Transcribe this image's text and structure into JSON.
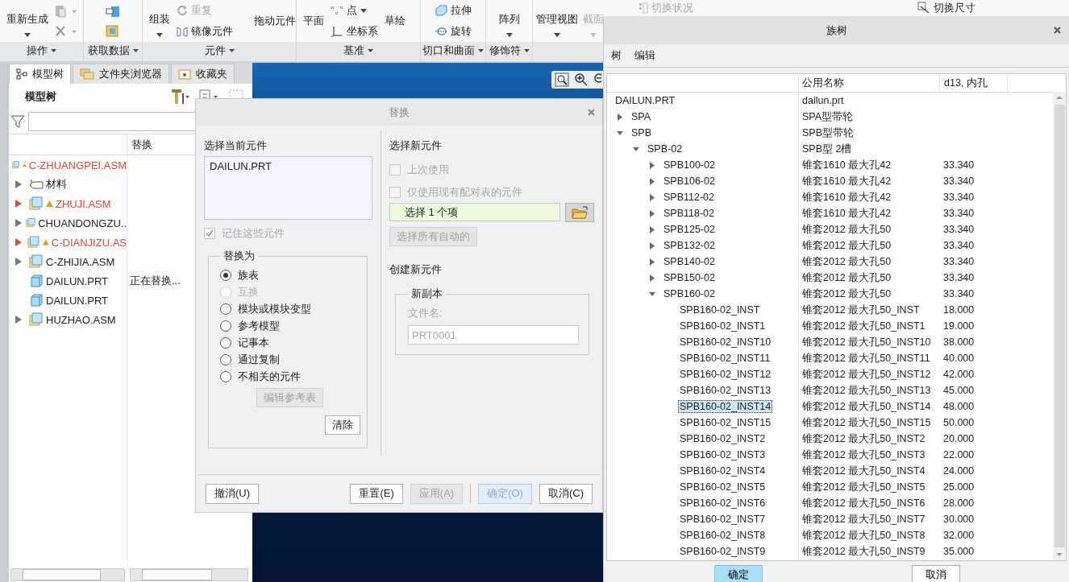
{
  "ribbon": {
    "groups": [
      {
        "label": "操作",
        "items": [
          {
            "label": "重新生成",
            "disabled": false
          }
        ]
      },
      {
        "label": "获取数据"
      },
      {
        "label": "元件",
        "items": [
          {
            "label": "组装",
            "disabled": false
          },
          {
            "label": "重复",
            "disabled": true
          },
          {
            "label": "镜像元件",
            "disabled": false
          },
          {
            "label": "拖动元件",
            "disabled": false
          }
        ]
      },
      {
        "label": "基准",
        "items": [
          {
            "label": "平面",
            "disabled": false
          },
          {
            "label": "点",
            "disabled": false
          },
          {
            "label": "坐标系",
            "disabled": false
          },
          {
            "label": "草绘",
            "disabled": false
          }
        ]
      },
      {
        "label": "切口和曲面",
        "items": [
          {
            "label": "拉伸",
            "disabled": false
          },
          {
            "label": "旋转",
            "disabled": false
          }
        ]
      },
      {
        "label": "修饰符",
        "items": [
          {
            "label": "阵列",
            "disabled": false
          }
        ]
      },
      {
        "items": [
          {
            "label": "管理视图",
            "disabled": false
          },
          {
            "label": "截面",
            "disabled": true
          }
        ]
      }
    ],
    "overflow_items": [
      {
        "label": "切换状况",
        "disabled": true
      },
      {
        "label": "切换尺寸",
        "disabled": false
      }
    ]
  },
  "left_panel": {
    "tabs": [
      {
        "label": "模型树",
        "selected": true
      },
      {
        "label": "文件夹浏览器",
        "selected": false
      },
      {
        "label": "收藏夹",
        "selected": false
      }
    ],
    "title": "模型树",
    "columns": [
      "替换"
    ],
    "tree": {
      "name": "C-ZHUANGPEI.ASM",
      "kind": "assembly",
      "warning": true,
      "children": [
        {
          "name": "材料",
          "kind": "material",
          "warning": false,
          "expanded": false
        },
        {
          "name": "ZHUJI.ASM",
          "kind": "assembly",
          "warning": true,
          "expanded": false
        },
        {
          "name": "CHUANDONGZU..",
          "kind": "assembly",
          "warning": false,
          "expanded": false
        },
        {
          "name": "C-DIANJIZU.AS",
          "kind": "assembly",
          "warning": true,
          "expanded": false
        },
        {
          "name": "C-ZHIJIA.ASM",
          "kind": "assembly",
          "warning": false,
          "expanded": false
        },
        {
          "name": "DAILUN.PRT",
          "kind": "part",
          "warning": false,
          "replace": "正在替换..."
        },
        {
          "name": "DAILUN.PRT",
          "kind": "part",
          "warning": false
        },
        {
          "name": "HUZHAO.ASM",
          "kind": "assembly",
          "warning": false,
          "expanded": false
        }
      ]
    }
  },
  "replace_dialog": {
    "title": "替换",
    "current_label": "选择当前元件",
    "current_items": [
      "DAILUN.PRT"
    ],
    "remember": {
      "label": "记住这些元件",
      "checked": true,
      "disabled": true
    },
    "replace_with": {
      "legend": "替换为",
      "options": [
        {
          "label": "族表",
          "selected": true,
          "disabled": false
        },
        {
          "label": "互换",
          "selected": false,
          "disabled": true
        },
        {
          "label": "模块或模块变型",
          "selected": false,
          "disabled": false
        },
        {
          "label": "参考模型",
          "selected": false,
          "disabled": false
        },
        {
          "label": "记事本",
          "selected": false,
          "disabled": false
        },
        {
          "label": "通过复制",
          "selected": false,
          "disabled": false
        },
        {
          "label": "不相关的元件",
          "selected": false,
          "disabled": false
        }
      ],
      "edit_button": {
        "label": "编辑参考表",
        "disabled": true
      },
      "clear_button": "清除"
    },
    "new_label": "选择新元件",
    "new_options": [
      {
        "label": "上次使用",
        "checked": false,
        "disabled": true
      },
      {
        "label": "仅使用现有配对表的元件",
        "checked": false,
        "disabled": true
      }
    ],
    "selector": "选择 1 个项",
    "auto_button": {
      "label": "选择所有自动的",
      "disabled": true
    },
    "create_label": "创建新元件",
    "copy": {
      "legend": "新副本",
      "file_label": "文件名:",
      "file_value": "PRT0001",
      "disabled": true
    },
    "buttons": [
      {
        "label": "撤消(U)",
        "disabled": false,
        "default": false
      },
      {
        "label": "重置(E)",
        "disabled": false,
        "default": false
      },
      {
        "label": "应用(A)",
        "disabled": true,
        "default": false
      },
      {
        "label": "确定(O)",
        "disabled": true,
        "default": true
      },
      {
        "label": "取消(C)",
        "disabled": false,
        "default": false
      }
    ]
  },
  "family_tree": {
    "title": "族树",
    "menu": [
      "树",
      "编辑"
    ],
    "columns": [
      "公用名称",
      "d13, 内孔"
    ],
    "rows": [
      {
        "name": "DAILUN.PRT",
        "common": "dailun.prt",
        "selected": false,
        "children": [
          {
            "name": "SPA",
            "common": "SPA型带轮",
            "expanded": false,
            "selected": false
          },
          {
            "name": "SPB",
            "common": "SPB型带轮",
            "expanded": true,
            "selected": false,
            "children": [
              {
                "name": "SPB-02",
                "common": "SPB型 2槽",
                "expanded": true,
                "selected": false,
                "children": [
                  {
                    "name": "SPB100-02",
                    "common": "锥套1610 最大孔42",
                    "value": "33.340",
                    "expanded": false,
                    "selected": false
                  },
                  {
                    "name": "SPB106-02",
                    "common": "锥套1610 最大孔42",
                    "value": "33.340",
                    "expanded": false,
                    "selected": false
                  },
                  {
                    "name": "SPB112-02",
                    "common": "锥套1610 最大孔42",
                    "value": "33.340",
                    "expanded": false,
                    "selected": false
                  },
                  {
                    "name": "SPB118-02",
                    "common": "锥套1610 最大孔42",
                    "value": "33.340",
                    "expanded": false,
                    "selected": false
                  },
                  {
                    "name": "SPB125-02",
                    "common": "锥套2012 最大孔50",
                    "value": "33.340",
                    "expanded": false,
                    "selected": false
                  },
                  {
                    "name": "SPB132-02",
                    "common": "锥套2012 最大孔50",
                    "value": "33.340",
                    "expanded": false,
                    "selected": false
                  },
                  {
                    "name": "SPB140-02",
                    "common": "锥套2012 最大孔50",
                    "value": "33.340",
                    "expanded": false,
                    "selected": false
                  },
                  {
                    "name": "SPB150-02",
                    "common": "锥套2012 最大孔50",
                    "value": "33.340",
                    "expanded": false,
                    "selected": false
                  },
                  {
                    "name": "SPB160-02",
                    "common": "锥套2012 最大孔50",
                    "value": "33.340",
                    "expanded": true,
                    "selected": false,
                    "children": [
                      {
                        "name": "SPB160-02_INST",
                        "common": "锥套2012 最大孔50_INST",
                        "value": "18.000",
                        "selected": false
                      },
                      {
                        "name": "SPB160-02_INST1",
                        "common": "锥套2012 最大孔50_INST1",
                        "value": "19.000",
                        "selected": false
                      },
                      {
                        "name": "SPB160-02_INST10",
                        "common": "锥套2012 最大孔50_INST10",
                        "value": "38.000",
                        "selected": false
                      },
                      {
                        "name": "SPB160-02_INST11",
                        "common": "锥套2012 最大孔50_INST11",
                        "value": "40.000",
                        "selected": false
                      },
                      {
                        "name": "SPB160-02_INST12",
                        "common": "锥套2012 最大孔50_INST12",
                        "value": "42.000",
                        "selected": false
                      },
                      {
                        "name": "SPB160-02_INST13",
                        "common": "锥套2012 最大孔50_INST13",
                        "value": "45.000",
                        "selected": false
                      },
                      {
                        "name": "SPB160-02_INST14",
                        "common": "锥套2012 最大孔50_INST14",
                        "value": "48.000",
                        "selected": true
                      },
                      {
                        "name": "SPB160-02_INST15",
                        "common": "锥套2012 最大孔50_INST15",
                        "value": "50.000",
                        "selected": false
                      },
                      {
                        "name": "SPB160-02_INST2",
                        "common": "锥套2012 最大孔50_INST2",
                        "value": "20.000",
                        "selected": false
                      },
                      {
                        "name": "SPB160-02_INST3",
                        "common": "锥套2012 最大孔50_INST3",
                        "value": "22.000",
                        "selected": false
                      },
                      {
                        "name": "SPB160-02_INST4",
                        "common": "锥套2012 最大孔50_INST4",
                        "value": "24.000",
                        "selected": false
                      },
                      {
                        "name": "SPB160-02_INST5",
                        "common": "锥套2012 最大孔50_INST5",
                        "value": "25.000",
                        "selected": false
                      },
                      {
                        "name": "SPB160-02_INST6",
                        "common": "锥套2012 最大孔50_INST6",
                        "value": "28.000",
                        "selected": false
                      },
                      {
                        "name": "SPB160-02_INST7",
                        "common": "锥套2012 最大孔50_INST7",
                        "value": "30.000",
                        "selected": false
                      },
                      {
                        "name": "SPB160-02_INST8",
                        "common": "锥套2012 最大孔50_INST8",
                        "value": "32.000",
                        "selected": false
                      },
                      {
                        "name": "SPB160-02_INST9",
                        "common": "锥套2012 最大孔50_INST9",
                        "value": "35.000",
                        "selected": false
                      }
                    ]
                  }
                ]
              }
            ]
          }
        ]
      }
    ],
    "buttons": [
      {
        "label": "确定",
        "default": true
      },
      {
        "label": "取消",
        "default": false
      }
    ]
  }
}
